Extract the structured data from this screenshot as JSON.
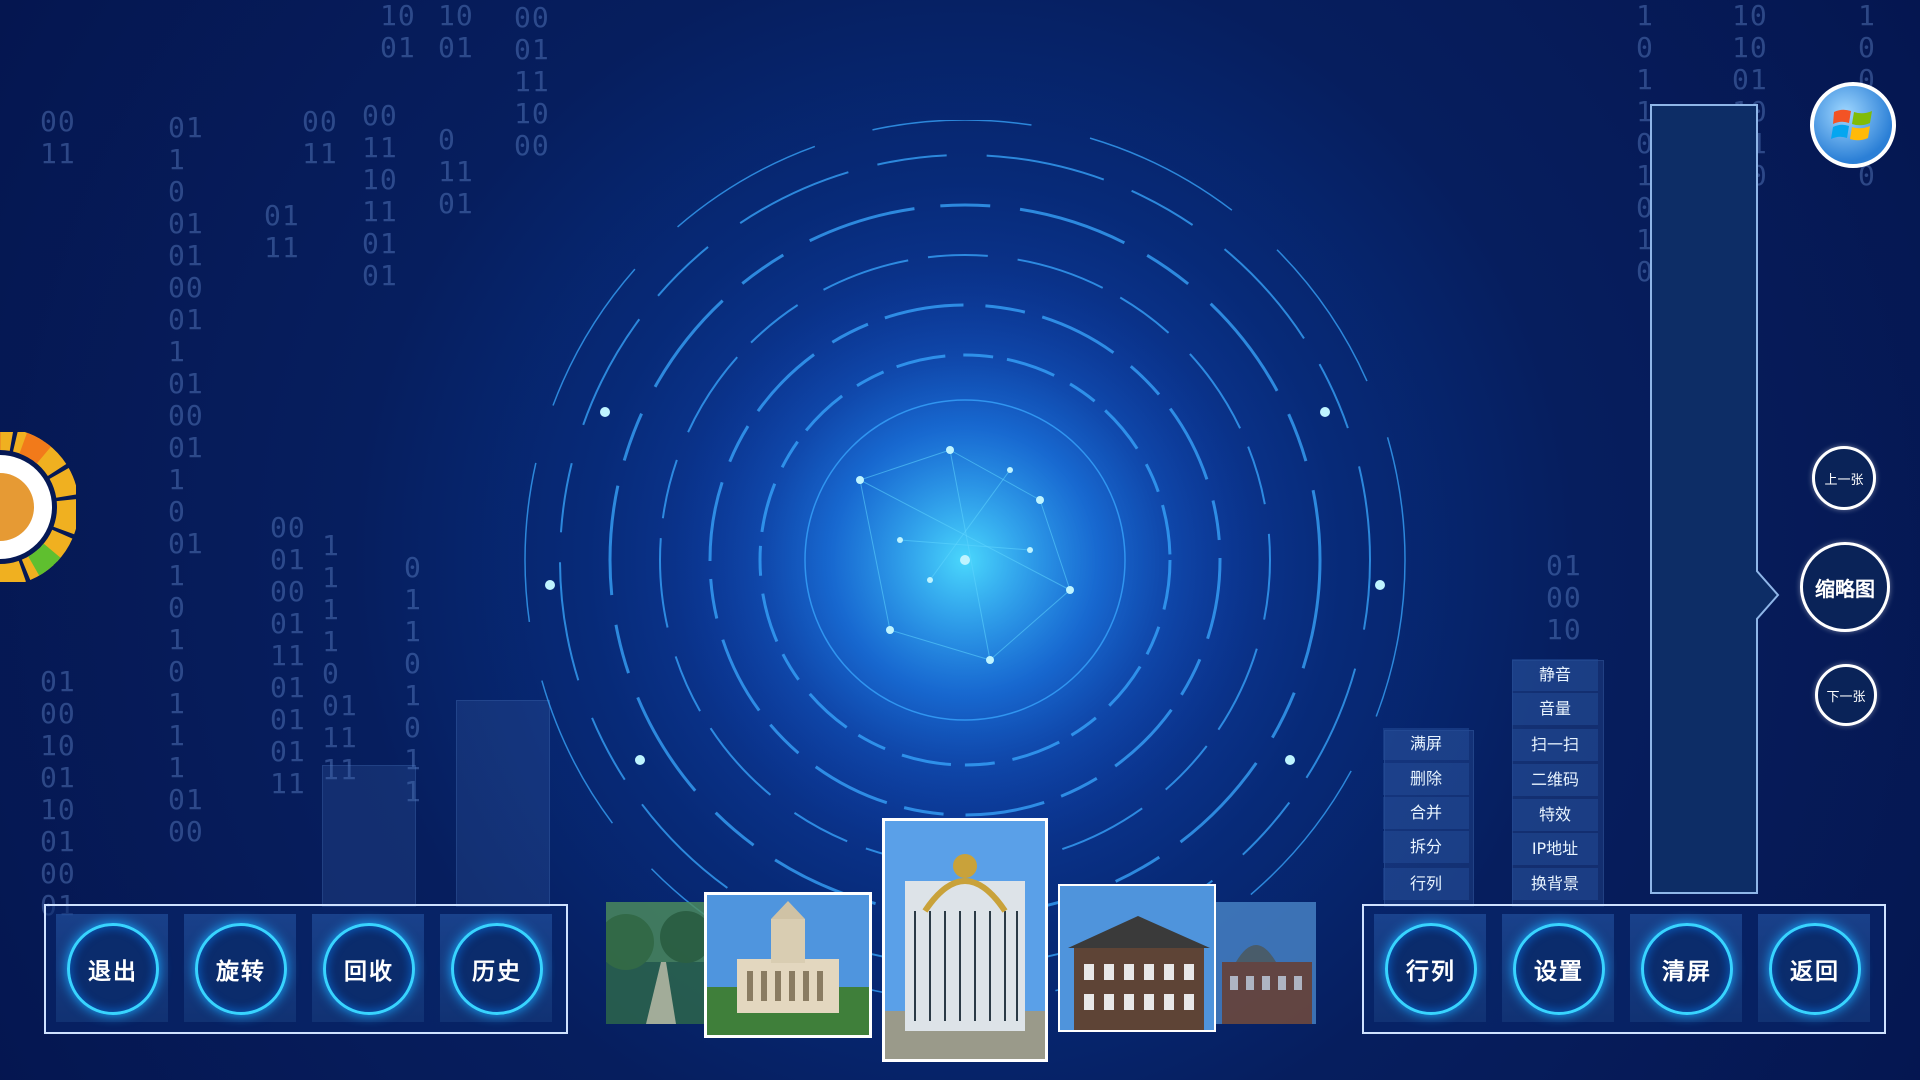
{
  "background": {
    "primary": "#061e5e",
    "accent": "#38d4ff"
  },
  "binary_columns": [
    "10\n01",
    "10\n01",
    "00\n01\n11\n10\n00",
    "00\n11",
    "01\n1\n0\n01\n01\n00\n01\n1\n01\n00\n01\n1\n0\n01\n1\n0\n1\n0\n1\n1\n1\n01\n00",
    "00\n11",
    "00\n11\n10\n11\n01\n01",
    "01\n11",
    "0\n11\n01",
    "00\n01\n00\n01\n11\n01\n01\n01\n11",
    "1\n1\n1\n1\n0\n01\n11\n11",
    "0\n1\n1\n0\n1\n0\n1\n1",
    "01\n00\n10\n01\n10\n01\n00\n01",
    "1\n0\n1\n1\n0\n1\n0\n1\n00",
    "10\n10\n01\n10\n01\n00",
    "1\n0\n0\n0\n0\n0",
    "01\n00\n10"
  ],
  "left_toolbar": {
    "buttons": [
      {
        "label": "退出"
      },
      {
        "label": "旋转"
      },
      {
        "label": "回收"
      },
      {
        "label": "历史"
      }
    ]
  },
  "right_toolbar": {
    "buttons": [
      {
        "label": "行列"
      },
      {
        "label": "设置"
      },
      {
        "label": "清屏"
      },
      {
        "label": "返回"
      }
    ]
  },
  "menu": {
    "left_column": [
      "满屏",
      "删除",
      "合并",
      "拆分",
      "行列"
    ],
    "right_column": [
      "静音",
      "音量",
      "扫一扫",
      "二维码",
      "特效",
      "IP地址",
      "换背景"
    ]
  },
  "side_controls": {
    "prev_label": "上一张",
    "thumbnail_label": "缩略图",
    "next_label": "下一张"
  },
  "start_icon": "windows-start-icon",
  "color_wheel_icon": "color-wheel-icon",
  "photos": [
    "forest-path",
    "parliament-building",
    "palace-gate",
    "brick-building",
    "station-building"
  ]
}
